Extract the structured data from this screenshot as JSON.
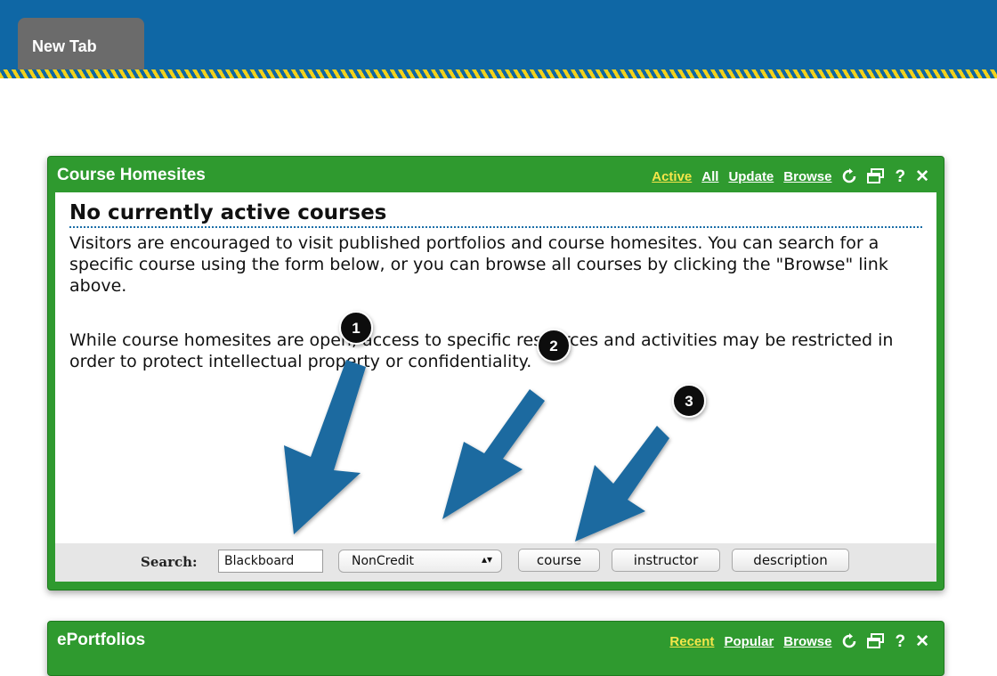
{
  "browser": {
    "tab_label": "New Tab"
  },
  "course_portlet": {
    "title": "Course Homesites",
    "links": [
      "Active",
      "All",
      "Update",
      "Browse"
    ],
    "heading": "No currently active courses",
    "paragraph1": "Visitors are encouraged to visit published portfolios and course homesites. You can search for a specific course using the form below, or you can browse all courses by clicking the \"Browse\" link above.",
    "paragraph2": "While course homesites are open, access to specific resources and activities may be restricted in order to protect intellectual property or confidentiality.",
    "search": {
      "label": "Search:",
      "input_value": "Blackboard",
      "select_value": "NonCredit",
      "buttons": [
        "course",
        "instructor",
        "description"
      ]
    }
  },
  "eportfolio_portlet": {
    "title": "ePortfolios",
    "links": [
      "Recent",
      "Popular",
      "Browse"
    ]
  },
  "annotations": [
    "1",
    "2",
    "3"
  ],
  "colors": {
    "header_blue": "#0f67a5",
    "stripe_yellow": "#f4d21a",
    "portlet_green": "#2f9a2f",
    "active_link": "#f5e64a",
    "arrow_blue": "#1c6aa0"
  }
}
